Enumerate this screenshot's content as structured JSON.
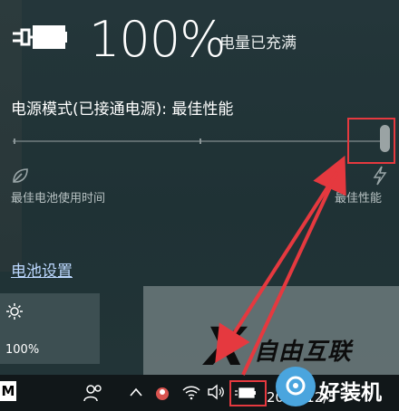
{
  "battery": {
    "percent_text": "100%",
    "status_text": "电量已充满",
    "mode_label": "电源模式(已接通电源): 最佳性能",
    "slider": {
      "level": 1.0
    },
    "left_caption": "最佳电池使用时间",
    "right_caption": "最佳性能",
    "settings_link": "电池设置"
  },
  "quick_action": {
    "icon": "brightness-sun-icon",
    "value": "100%"
  },
  "taskbar": {
    "start_glyph": "M",
    "date_text": "2017/12/5",
    "icons": [
      "people-icon",
      "chevron-up-icon",
      "app-icon",
      "wifi-icon",
      "volume-icon",
      "battery-icon"
    ]
  },
  "watermark": {
    "logo_glyph": "X",
    "logo_text": "自由互联",
    "brand_text": "好装机"
  },
  "colors": {
    "highlight": "#e5393f",
    "link": "#bcd8ff"
  }
}
